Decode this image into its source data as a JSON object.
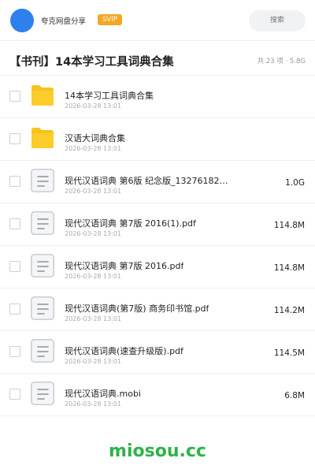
{
  "header": {
    "sharer_name": "夸克网盘分享",
    "badge": "SVIP",
    "search_placeholder": "搜索"
  },
  "folder": {
    "title": "【书刊】14本学习工具词典合集",
    "meta": "共 23 项 · 5.8G"
  },
  "colors": {
    "avatar": "#2f80ed",
    "svip_badge": "#f5a623",
    "folder_icon": "#f7c21c",
    "watermark": "#2fb24a"
  },
  "files": [
    {
      "name": "14本学习工具词典合集",
      "date": "2026-03-28 13:01",
      "size": "",
      "icon": "folder-icon"
    },
    {
      "name": "汉语大词典合集",
      "date": "2026-03-28 13:01",
      "size": "",
      "icon": "folder-icon"
    },
    {
      "name": "现代汉语词典  第6版  纪念版_13276182…",
      "date": "2026-03-28 13:01",
      "size": "1.0G",
      "icon": "document-icon"
    },
    {
      "name": "现代汉语词典 第7版 2016(1).pdf",
      "date": "2026-03-28 13:01",
      "size": "114.8M",
      "icon": "document-icon"
    },
    {
      "name": "现代汉语词典 第7版 2016.pdf",
      "date": "2026-03-28 13:01",
      "size": "114.8M",
      "icon": "document-icon"
    },
    {
      "name": "现代汉语词典(第7版) 商务印书馆.pdf",
      "date": "2026-03-28 13:01",
      "size": "114.2M",
      "icon": "document-icon"
    },
    {
      "name": "现代汉语词典(速查升级版).pdf",
      "date": "2026-03-28 13:01",
      "size": "114.5M",
      "icon": "document-icon"
    },
    {
      "name": "现代汉语词典.mobi",
      "date": "2026-03-28 13:01",
      "size": "6.8M",
      "icon": "document-icon"
    }
  ],
  "watermark": "miosou.cc"
}
